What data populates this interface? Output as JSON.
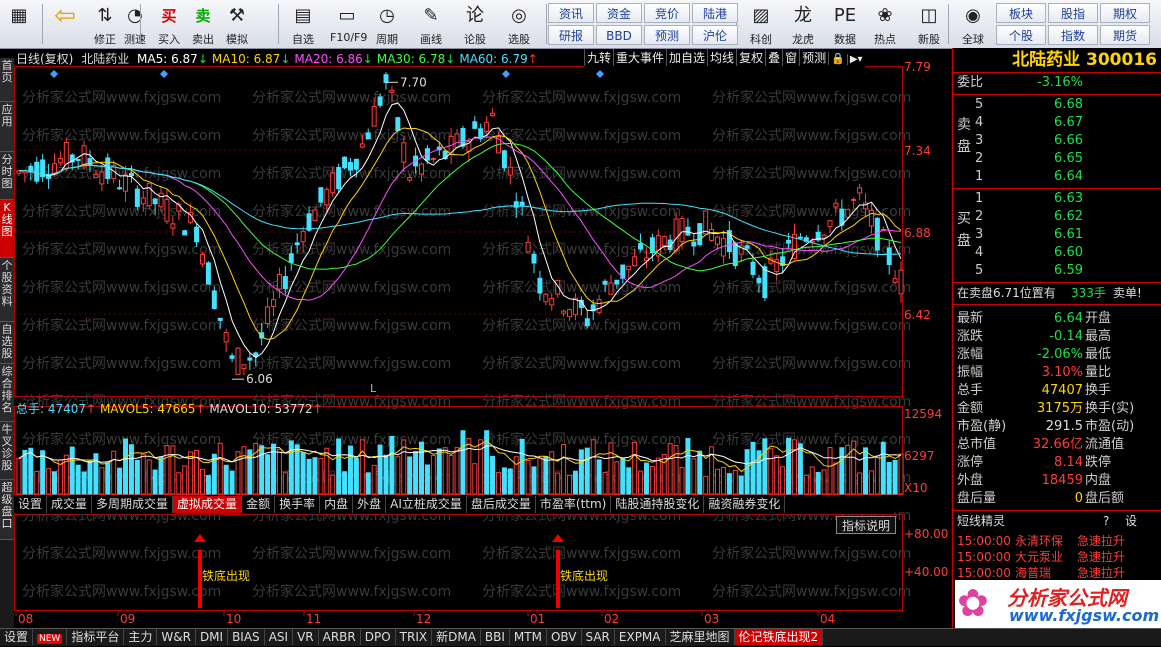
{
  "toolbar": {
    "buttons": [
      {
        "label": "",
        "icon": "app-grid-icon"
      },
      {
        "label": "",
        "icon": "back-arrow-icon"
      },
      {
        "label": "修正",
        "icon": "up-down-arrows-icon"
      },
      {
        "label": "测速",
        "icon": "speed-icon"
      },
      {
        "label": "买入",
        "icon": "buy-icon"
      },
      {
        "label": "卖出",
        "icon": "sell-icon"
      },
      {
        "label": "模拟",
        "icon": "hammer-icon"
      },
      {
        "label": "自选",
        "icon": "star-icon"
      },
      {
        "label": "F10/F9",
        "icon": "f10-icon"
      },
      {
        "label": "周期",
        "icon": "clock-icon"
      },
      {
        "label": "画线",
        "icon": "pen-icon"
      },
      {
        "label": "论股",
        "icon": "discuss-icon"
      },
      {
        "label": "选股",
        "icon": "stock-select-icon"
      },
      {
        "label": "科创",
        "icon": "chart-icon"
      },
      {
        "label": "龙虎",
        "icon": "dragon-icon"
      },
      {
        "label": "数据",
        "icon": "pe-icon"
      },
      {
        "label": "热点",
        "icon": "hot-icon"
      },
      {
        "label": "新股",
        "icon": "ipo-icon"
      },
      {
        "label": "全球",
        "icon": "globe-icon"
      }
    ],
    "quick": [
      [
        "资讯",
        "资金",
        "竞价",
        "陆港"
      ],
      [
        "研报",
        "BBD",
        "预测",
        "沪伦"
      ]
    ],
    "right_quick": [
      [
        "板块",
        "股指",
        "期权"
      ],
      [
        "个股",
        "指数",
        "期货"
      ]
    ]
  },
  "left_tabs": [
    "首页",
    "应用",
    "分时图",
    "K线图",
    "个股资料",
    "自选股",
    "综合排名",
    "牛叉诊股",
    "超级盘口"
  ],
  "chart": {
    "period": "日线(复权)",
    "stock_name": "北陆药业",
    "ma": [
      {
        "label": "MA5: 6.87",
        "arrow": "↓",
        "color": "#ffffff"
      },
      {
        "label": "MA10: 6.87",
        "arrow": "↓",
        "color": "#ffd400"
      },
      {
        "label": "MA20: 6.86",
        "arrow": "↓",
        "color": "#ff4dff"
      },
      {
        "label": "MA30: 6.78",
        "arrow": "↓",
        "color": "#3cff3c"
      },
      {
        "label": "MA60: 6.79",
        "arrow": "↑",
        "color": "#44e0ff"
      }
    ],
    "controls": [
      "九转",
      "重大事件",
      "加自选",
      "均线",
      "复权",
      "叠",
      "窗",
      "预测"
    ],
    "price_labels": [
      "7.79",
      "7.34",
      "6.88",
      "6.42"
    ],
    "high_label": "7.70",
    "low_label": "6.06",
    "l_marker": "L",
    "volume": {
      "label": "总手: 47407",
      "mavol5": "MAVOL5: 47665",
      "mavol10": "MAVOL10: 53772",
      "labels": [
        "12594",
        "6297",
        "X10"
      ]
    },
    "volume_tabs": [
      "设置",
      "成交量",
      "多周期成交量",
      "虚拟成交量",
      "金额",
      "换手率",
      "内盘",
      "外盘",
      "AI立桩成交量",
      "盘后成交量",
      "市盈率(ttm)",
      "陆股通持股变化",
      "融资融券变化"
    ],
    "indicator_button": "指标说明",
    "indicator_labels": [
      "+80.00",
      "+40.00"
    ],
    "signals": [
      "铁底出现",
      "铁底出现"
    ],
    "months": [
      "08",
      "09",
      "10",
      "11",
      "12",
      "01",
      "02",
      "03",
      "04"
    ],
    "watermark_text": "分析家公式网www.fxjgsw.com"
  },
  "bottom_tabs": [
    "设置",
    "NEW",
    "指标平台",
    "主力",
    "W&R",
    "DMI",
    "BIAS",
    "ASI",
    "VR",
    "ARBR",
    "DPO",
    "TRIX",
    "新DMA",
    "BBI",
    "MTM",
    "OBV",
    "SAR",
    "EXPMA",
    "芝麻里地图",
    "伦记铁底出现2"
  ],
  "quote": {
    "title": "北陆药业 300016",
    "weibi_label": "委比",
    "weibi_value": "-3.16%",
    "sell_label": "卖盘",
    "buy_label": "买盘",
    "sell": [
      [
        "5",
        "6.68"
      ],
      [
        "4",
        "6.67"
      ],
      [
        "3",
        "6.66"
      ],
      [
        "2",
        "6.65"
      ],
      [
        "1",
        "6.64"
      ]
    ],
    "buy": [
      [
        "1",
        "6.63"
      ],
      [
        "2",
        "6.62"
      ],
      [
        "3",
        "6.61"
      ],
      [
        "4",
        "6.60"
      ],
      [
        "5",
        "6.59"
      ]
    ],
    "notice": "在卖盘6.71位置有",
    "notice_qty": "333手",
    "notice_tail": "卖单!",
    "stats": [
      [
        "最新",
        "6.64",
        "开盘"
      ],
      [
        "涨跌",
        "-0.14",
        "最高"
      ],
      [
        "涨幅",
        "-2.06%",
        "最低"
      ],
      [
        "振幅",
        "3.10%",
        "量比"
      ],
      [
        "总手",
        "47407",
        "换手"
      ],
      [
        "金额",
        "3175万",
        "换手(实)"
      ],
      [
        "市盈(静)",
        "291.5",
        "市盈(动)"
      ],
      [
        "总市值",
        "32.66亿",
        "流通值"
      ],
      [
        "涨停",
        "8.14",
        "跌停"
      ],
      [
        "外盘",
        "18459",
        "内盘"
      ],
      [
        "盘后量",
        "0",
        "盘后额"
      ]
    ],
    "short_title": "短线精灵",
    "short_buttons": [
      "?",
      "设"
    ],
    "short_items": [
      [
        "15:00:00",
        "永清环保",
        "急速拉升"
      ],
      [
        "15:00:00",
        "大元泵业",
        "急速拉升"
      ],
      [
        "15:00:00",
        "海普瑞",
        "急速拉升"
      ]
    ]
  },
  "brand": {
    "line1": "分析家公式网",
    "line2": "www.fxjgsw.com"
  }
}
